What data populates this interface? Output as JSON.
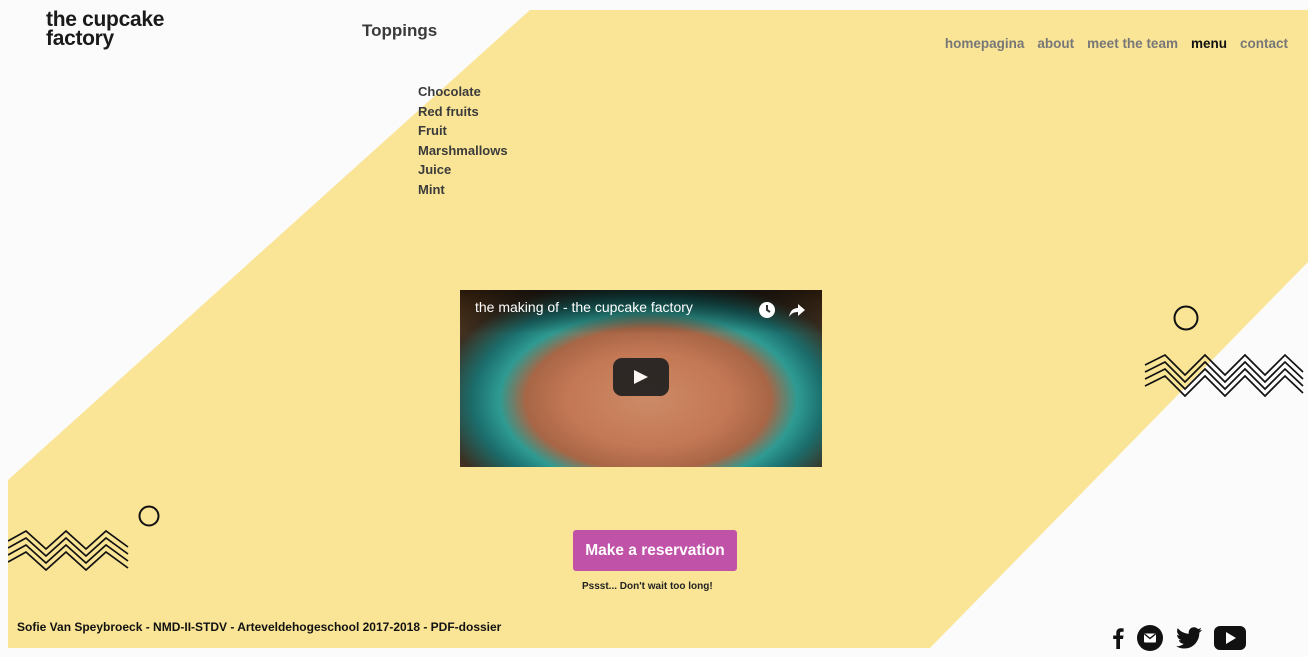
{
  "brand": {
    "line1": "the cupcake",
    "line2": "factory"
  },
  "section_title": "Toppings",
  "nav": [
    {
      "label": "homepagina",
      "active": false
    },
    {
      "label": "about",
      "active": false
    },
    {
      "label": "meet the team",
      "active": false
    },
    {
      "label": "menu",
      "active": true
    },
    {
      "label": "contact",
      "active": false
    }
  ],
  "toppings": [
    "Chocolate",
    "Red fruits",
    "Fruit",
    "Marshmallows",
    "Juice",
    "Mint"
  ],
  "video": {
    "title": "the making of - the cupcake factory"
  },
  "cta": {
    "label": "Make a reservation",
    "hint": "Pssst... Don't wait too long!"
  },
  "footer": {
    "credit": "Sofie Van Speybroeck - NMD-II-STDV - Arteveldehogeschool 2017-2018 - PDF-dossier"
  },
  "social": [
    "facebook-icon",
    "mail-icon",
    "twitter-icon",
    "youtube-icon"
  ],
  "colors": {
    "band": "#fae596",
    "accent": "#c052a8",
    "background": "#fbfbfb"
  }
}
